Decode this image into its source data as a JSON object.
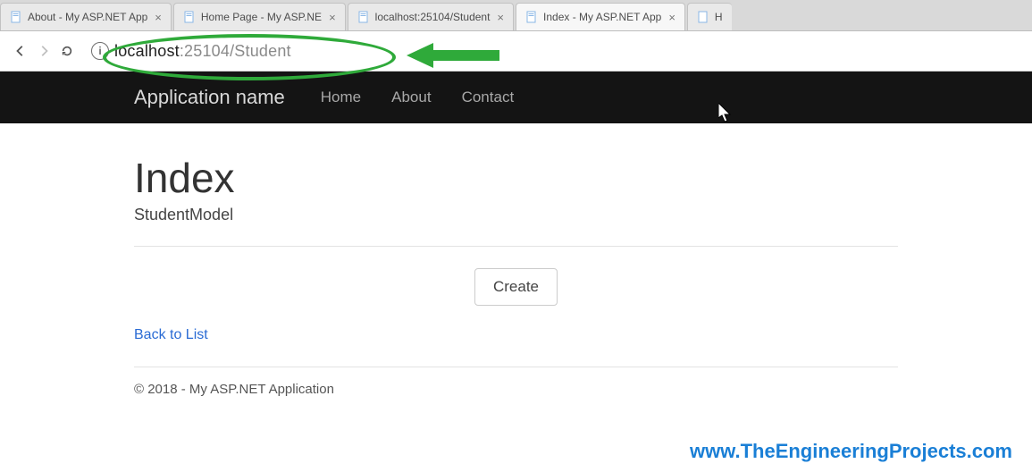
{
  "browser": {
    "tabs": [
      {
        "title": "About - My ASP.NET App",
        "active": false
      },
      {
        "title": "Home Page - My ASP.NE",
        "active": false
      },
      {
        "title": "localhost:25104/Student",
        "active": false
      },
      {
        "title": "Index - My ASP.NET App",
        "active": true
      },
      {
        "title": "H",
        "active": false,
        "cut": true
      }
    ],
    "url_host": "localhost",
    "url_rest": ":25104/Student"
  },
  "appbar": {
    "brand": "Application name",
    "links": [
      "Home",
      "About",
      "Contact"
    ]
  },
  "page": {
    "heading": "Index",
    "subtitle": "StudentModel",
    "create_label": "Create",
    "back_label": "Back to List",
    "footer": "© 2018 - My ASP.NET Application"
  },
  "watermark": "www.TheEngineeringProjects.com",
  "annotation_color": "#2faa3a"
}
